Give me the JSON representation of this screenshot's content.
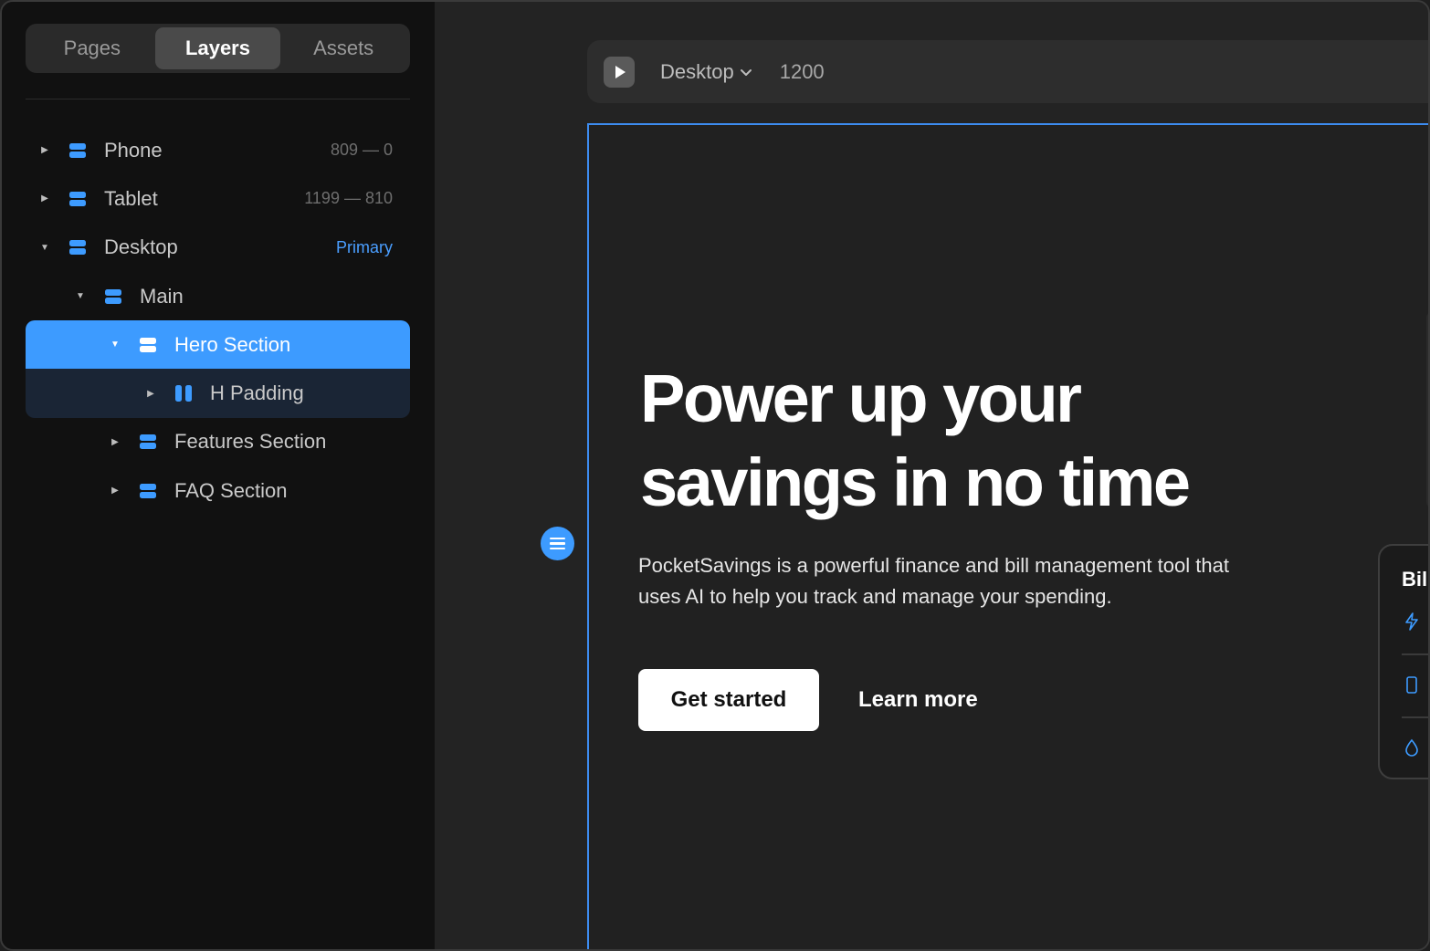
{
  "sidebar": {
    "tabs": [
      {
        "label": "Pages",
        "active": false
      },
      {
        "label": "Layers",
        "active": true
      },
      {
        "label": "Assets",
        "active": false
      }
    ],
    "layers": [
      {
        "name": "Phone",
        "meta": "809 — 0",
        "indent": 0,
        "expanded": false
      },
      {
        "name": "Tablet",
        "meta": "1199 — 810",
        "indent": 0,
        "expanded": false
      },
      {
        "name": "Desktop",
        "meta": "Primary",
        "indent": 0,
        "expanded": true
      },
      {
        "name": "Main",
        "meta": "",
        "indent": 1,
        "expanded": true
      },
      {
        "name": "Hero Section",
        "meta": "",
        "indent": 2,
        "expanded": true,
        "selected": true
      },
      {
        "name": "H Padding",
        "meta": "",
        "indent": 3,
        "expanded": false
      },
      {
        "name": "Features Section",
        "meta": "",
        "indent": 2,
        "expanded": false
      },
      {
        "name": "FAQ Section",
        "meta": "",
        "indent": 2,
        "expanded": false
      }
    ]
  },
  "toolbar": {
    "breakpoint": "Desktop",
    "width": "1200"
  },
  "hero": {
    "title_line1": "Power up your",
    "title_line2": "savings in no time",
    "subtitle_line1": "PocketSavings is a powerful finance and bill management tool that",
    "subtitle_line2": "uses AI to help you track and manage your spending.",
    "primary_cta": "Get started",
    "secondary_cta": "Learn more"
  },
  "bill_card": {
    "title": "Bill"
  },
  "colors": {
    "accent": "#3d9bff",
    "sidebar_bg": "#111111",
    "canvas_bg": "#212121",
    "frame_border": "#3d8cf0"
  }
}
